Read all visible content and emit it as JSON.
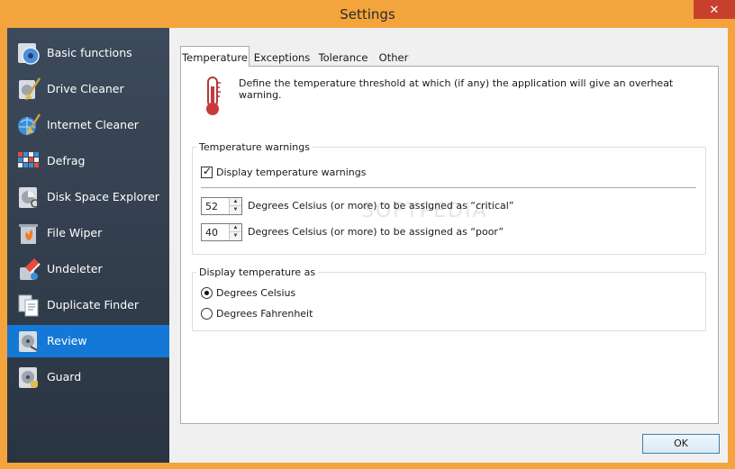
{
  "window": {
    "title": "Settings",
    "close_glyph": "✕"
  },
  "sidebar": {
    "items": [
      {
        "label": "Basic functions",
        "icon": "gear-disc-icon"
      },
      {
        "label": "Drive Cleaner",
        "icon": "broom-disk-icon"
      },
      {
        "label": "Internet Cleaner",
        "icon": "globe-broom-icon"
      },
      {
        "label": "Defrag",
        "icon": "defrag-grid-icon"
      },
      {
        "label": "Disk Space Explorer",
        "icon": "disk-pie-icon"
      },
      {
        "label": "File Wiper",
        "icon": "fire-bin-icon"
      },
      {
        "label": "Undeleter",
        "icon": "eraser-icon"
      },
      {
        "label": "Duplicate Finder",
        "icon": "documents-icon"
      },
      {
        "label": "Review",
        "icon": "disk-review-icon"
      },
      {
        "label": "Guard",
        "icon": "disk-guard-icon"
      }
    ],
    "active": "Review"
  },
  "tabs": [
    {
      "label": "Temperature"
    },
    {
      "label": "Exceptions"
    },
    {
      "label": "Tolerance"
    },
    {
      "label": "Other"
    }
  ],
  "temperature": {
    "description": "Define the temperature threshold at which (if any) the application will give an overheat warning.",
    "warnings_group": {
      "legend": "Temperature warnings",
      "display_checkbox_label": "Display temperature warnings",
      "display_checked": true,
      "critical_value": "52",
      "critical_label": "Degrees Celsius (or more) to be assigned as “critical”",
      "poor_value": "40",
      "poor_label": "Degrees Celsius (or more) to be assigned as “poor”"
    },
    "display_group": {
      "legend": "Display temperature as",
      "option_celsius": "Degrees Celsius",
      "option_fahrenheit": "Degrees Fahrenheit",
      "selected": "Degrees Celsius"
    }
  },
  "footer": {
    "ok_label": "OK"
  },
  "watermark": "SOFTPEDIA",
  "colors": {
    "title_bar": "#f4a43c",
    "sidebar_active": "#1479d6",
    "close_button": "#c7402c"
  }
}
